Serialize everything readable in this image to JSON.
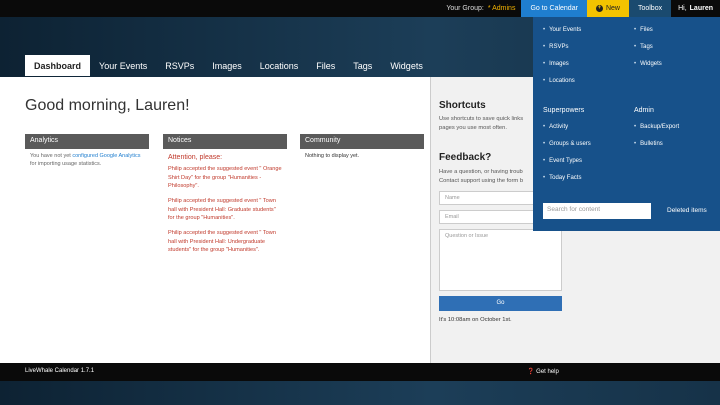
{
  "topbar": {
    "group_label": "Your Group:",
    "group_name": "* Admins",
    "calendar_btn": "Go to Calendar",
    "new_btn": "New",
    "toolbox_btn": "Toolbox",
    "user_greeting": "Hi,",
    "user_name": "Lauren"
  },
  "tabs": [
    "Dashboard",
    "Your Events",
    "RSVPs",
    "Images",
    "Locations",
    "Files",
    "Tags",
    "Widgets"
  ],
  "main": {
    "greeting": "Good morning, Lauren!",
    "analytics": {
      "title": "Analytics",
      "text_before": "You have not yet ",
      "link": "configured Google Analytics",
      "text_after": " for importing usage statistics."
    },
    "notices": {
      "title": "Notices",
      "attention": "Attention, please:",
      "items": [
        "Philip accepted the suggested event \" Orange Shirt Day\" for the group \"Humanities - Philosophy\".",
        "Philip accepted the suggested event \" Town hall with President Hall: Graduate students\" for the group \"Humanities\".",
        "Philip accepted the suggested event \" Town hall with President Hall: Undergraduate students\" for the group \"Humanities\"."
      ]
    },
    "community": {
      "title": "Community",
      "text": "Nothing to display yet."
    }
  },
  "side": {
    "shortcuts_title": "Shortcuts",
    "shortcuts_desc_1": "Use shortcuts to save quick links",
    "shortcuts_desc_2": "pages you use most often.",
    "feedback_title": "Feedback?",
    "feedback_desc_1": "Have a question, or having troub",
    "feedback_desc_2": "Contact support using the form b",
    "name_placeholder": "Name",
    "email_placeholder": "Email",
    "question_placeholder": "Question or Issue",
    "go_btn": "Go",
    "time_note": "It's 10:08am on October 1st."
  },
  "toolbox": {
    "col1": [
      "Your Events",
      "RSVPs",
      "Images",
      "Locations"
    ],
    "col2": [
      "Files",
      "Tags",
      "Widgets"
    ],
    "superpowers_title": "Superpowers",
    "superpowers": [
      "Activity",
      "Groups & users",
      "Event Types",
      "Today Facts"
    ],
    "admin_title": "Admin",
    "admin": [
      "Backup/Export",
      "Bulletins"
    ],
    "search_placeholder": "Search for content",
    "deleted_items": "Deleted items"
  },
  "footer": {
    "version": "LiveWhale Calendar 1.7.1",
    "help": "Get help"
  }
}
